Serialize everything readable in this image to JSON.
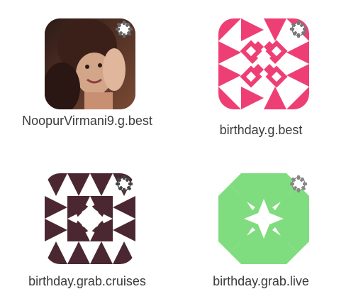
{
  "accounts": [
    {
      "name": "NoopurVirmani9.g.best",
      "avatar": "photo-avatar",
      "has_settings": true
    },
    {
      "name": "birthday.g.best",
      "avatar": "pink-pattern-avatar",
      "accent": "#ee3f74",
      "has_settings": true
    },
    {
      "name": "birthday.grab.cruises",
      "avatar": "purple-pattern-avatar",
      "accent": "#4a2731",
      "has_settings": true
    },
    {
      "name": "birthday.grab.live",
      "avatar": "green-pattern-avatar",
      "accent": "#7fdc7f",
      "has_settings": true
    }
  ]
}
